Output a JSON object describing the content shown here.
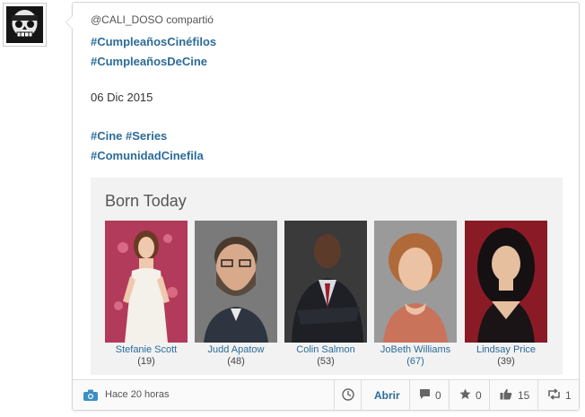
{
  "post": {
    "user": "@CALI_DOSO",
    "action": "compartió",
    "hashtags_top": [
      "#CumpleañosCinéfilos",
      "#CumpleañosDeCine"
    ],
    "date": "06 Dic 2015",
    "hashtags_bottom": [
      "#Cine #Series",
      "#ComunidadCinefila"
    ]
  },
  "born": {
    "title": "Born Today",
    "people": [
      {
        "name": "Stefanie Scott",
        "age": "(19)"
      },
      {
        "name": "Judd Apatow",
        "age": "(48)"
      },
      {
        "name": "Colin Salmon",
        "age": "(53)"
      },
      {
        "name": "JoBeth Williams (67)",
        "age": ""
      },
      {
        "name": "Lindsay Price",
        "age": "(39)"
      }
    ]
  },
  "footer": {
    "time": "Hace 20 horas",
    "open": "Abrir",
    "comments": "0",
    "stars": "0",
    "likes": "15",
    "shares": "1"
  }
}
